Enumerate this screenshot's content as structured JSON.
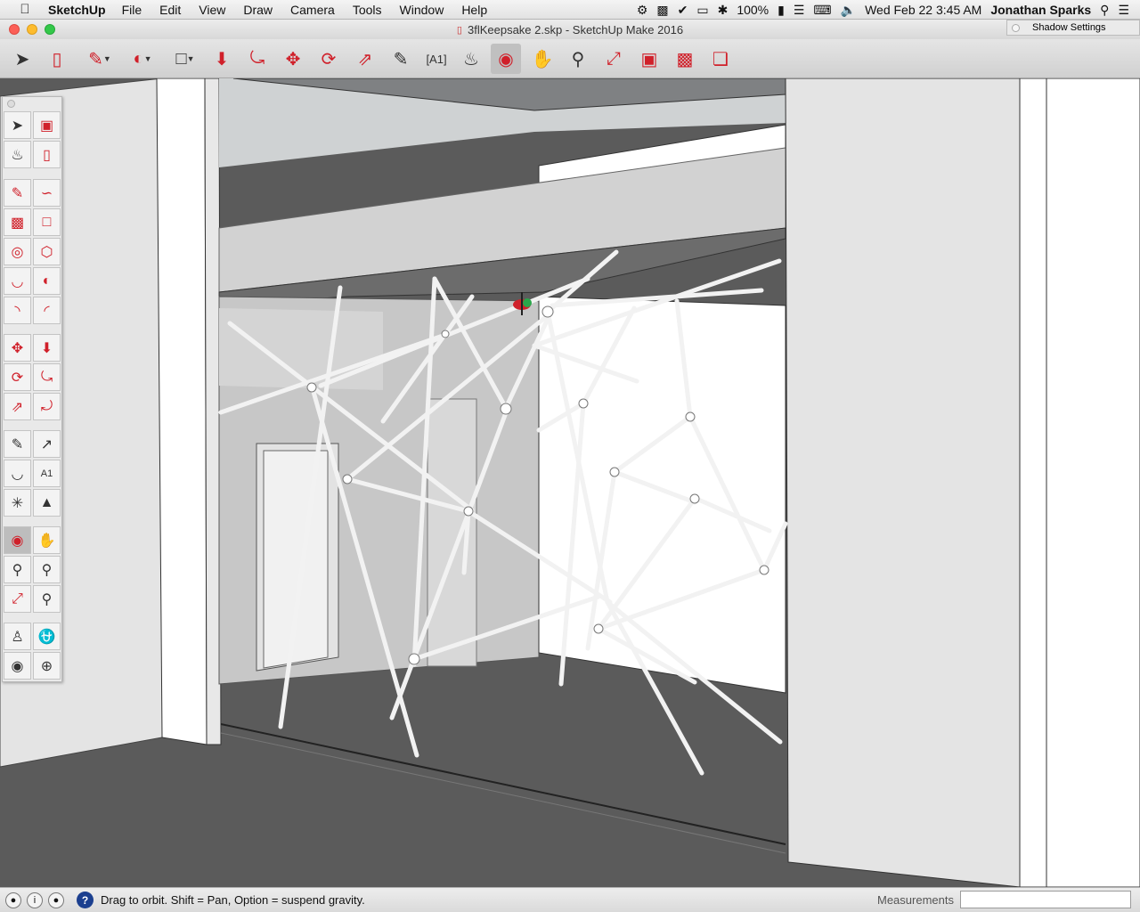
{
  "menubar": {
    "app_name": "SketchUp",
    "menus": [
      "File",
      "Edit",
      "View",
      "Draw",
      "Camera",
      "Tools",
      "Window",
      "Help"
    ],
    "battery": "100%",
    "datetime": "Wed Feb 22  3:45 AM",
    "user": "Jonathan Sparks"
  },
  "window": {
    "title": "3flKeepsake 2.skp - SketchUp Make 2016"
  },
  "shadow_panel": {
    "title": "Shadow Settings"
  },
  "toolbar": {
    "tools": [
      "select",
      "eraser",
      "pencil",
      "arc",
      "rectangle",
      "push-pull",
      "follow-me",
      "move",
      "rotate",
      "scale",
      "tape-measure",
      "text",
      "paint-bucket",
      "orbit",
      "pan",
      "zoom",
      "zoom-extents",
      "3d-warehouse",
      "extension-warehouse",
      "layout"
    ],
    "active": "orbit"
  },
  "palette": {
    "active": "orbit"
  },
  "statusbar": {
    "status_text": "Drag to orbit. Shift = Pan, Option = suspend gravity.",
    "measurements_label": "Measurements",
    "measurements_value": ""
  },
  "colors": {
    "floor": "#5b5b5b",
    "wall_light": "#e4e4e4",
    "ceiling": "#cfd2d3",
    "accent_red": "#d0202a"
  }
}
